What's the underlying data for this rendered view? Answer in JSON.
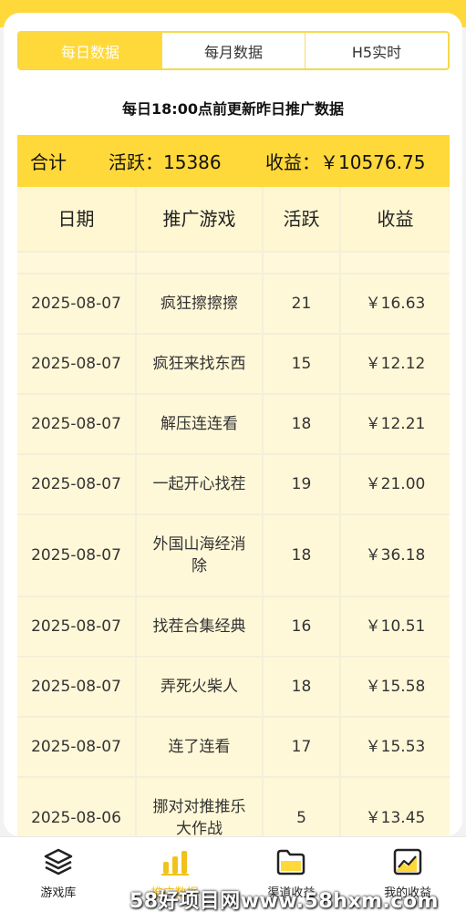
{
  "tabs": [
    "每日数据",
    "每月数据",
    "H5实时"
  ],
  "notice": "每日18:00点前更新昨日推广数据",
  "summary": {
    "label": "合计",
    "active": "活跃：15386",
    "income": "收益：￥10576.75"
  },
  "table": {
    "headers": [
      "日期",
      "推广游戏",
      "活跃",
      "收益"
    ],
    "rows": [
      {
        "date": "2025-08-07",
        "game": "疯狂擦擦擦",
        "active": "21",
        "income": "￥16.63"
      },
      {
        "date": "2025-08-07",
        "game": "疯狂来找东西",
        "active": "15",
        "income": "￥12.12"
      },
      {
        "date": "2025-08-07",
        "game": "解压连连看",
        "active": "18",
        "income": "￥12.21"
      },
      {
        "date": "2025-08-07",
        "game": "一起开心找茬",
        "active": "19",
        "income": "￥21.00"
      },
      {
        "date": "2025-08-07",
        "game": "外国山海经消除",
        "active": "18",
        "income": "￥36.18"
      },
      {
        "date": "2025-08-07",
        "game": "找茬合集经典",
        "active": "16",
        "income": "￥10.51"
      },
      {
        "date": "2025-08-07",
        "game": "弄死火柴人",
        "active": "18",
        "income": "￥15.58"
      },
      {
        "date": "2025-08-07",
        "game": "连了连看",
        "active": "17",
        "income": "￥15.53"
      },
      {
        "date": "2025-08-06",
        "game": "挪对对推推乐大作战",
        "active": "5",
        "income": "￥13.45"
      }
    ]
  },
  "nav": [
    {
      "label": "游戏库",
      "icon": "layers-icon"
    },
    {
      "label": "推广数据",
      "icon": "bar-chart-icon"
    },
    {
      "label": "渠道收益",
      "icon": "folder-icon"
    },
    {
      "label": "我的收益",
      "icon": "trend-chart-icon"
    }
  ],
  "watermark": "58好项目网www.58hxm.com",
  "colors": {
    "accent": "#ffd83a",
    "row_bg": "#fff8d8",
    "active_nav": "#f2c21b"
  }
}
